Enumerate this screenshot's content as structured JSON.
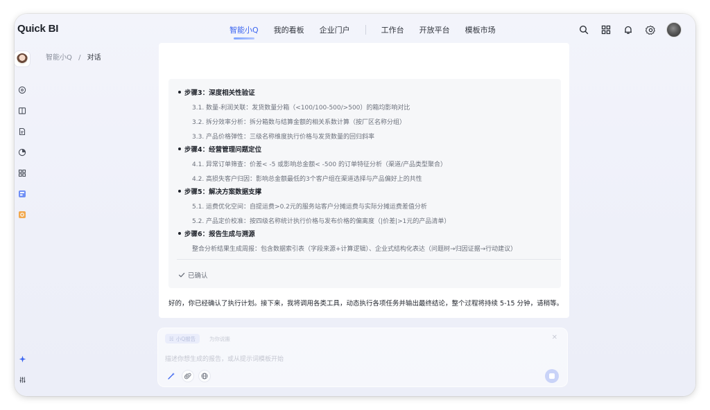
{
  "app": {
    "title": "Quick BI"
  },
  "nav": {
    "tabs": [
      {
        "label": "智能小Q",
        "active": true
      },
      {
        "label": "我的看板"
      },
      {
        "label": "企业门户"
      },
      {
        "label": "工作台"
      },
      {
        "label": "开放平台"
      },
      {
        "label": "模板市场"
      }
    ]
  },
  "header_icons": [
    "search-icon",
    "grid-icon",
    "bell-icon",
    "gear-icon",
    "user-avatar"
  ],
  "rail": {
    "icons": [
      "chat-icon",
      "book-icon",
      "document-icon",
      "data-icon",
      "apps-icon",
      "dashboard-icon",
      "report-icon"
    ],
    "bottom_icons": [
      "sparkle-icon",
      "settings-sliders-icon"
    ]
  },
  "breadcrumb": {
    "root": "智能小Q",
    "sep": "/",
    "current": "对话"
  },
  "plan": {
    "steps": [
      {
        "title": "步骤3：深度相关性验证",
        "lines": [
          "3.1. 数量-利润关联：发货数量分箱（<100/100-500/>500）的箱均影响对比",
          "3.2. 拆分效率分析：拆分箱数与结算金额的相关系数计算（按厂区名称分组）",
          "3.3. 产品价格弹性：三级名称维度执行价格与发货数量的回归斜率"
        ]
      },
      {
        "title": "步骤4：经营管理问题定位",
        "lines": [
          "4.1. 异常订单筛查：价差< -5 或影响总金额< -500 的订单特征分析（渠道/产品类型聚合）",
          "4.2. 高损失客户归因：影响总金额最低的3个客户组在渠道选择与产品偏好上的共性"
        ]
      },
      {
        "title": "步骤5：解决方案数据支撑",
        "lines": [
          "5.1. 运费优化空间：自提运费>0.2元的服务站客户分摊运费与实际分摊运费差值分析",
          "5.2. 产品定价校准：按四级名称统计执行价格与发布价格的偏离度（|价差|>1元的产品清单）"
        ]
      },
      {
        "title": "步骤6：报告生成与溯源",
        "lines": [
          "整合分析结果生成周报：包含数据索引表（字段来源+计算逻辑）、企业式结构化表达（问题树→归因证据→行动建议）"
        ]
      }
    ],
    "confirmed_label": "已确认"
  },
  "reply": "好的，你已经确认了执行计划。接下来，我将调用各类工具，动态执行各项任务并输出最终结论，整个过程将持续 5-15 分钟，请稍等。",
  "input": {
    "chip_label": "小Q报告",
    "chip_sub": "为你说搬",
    "placeholder": "描述你想生成的报告，或从提示词模板开始"
  },
  "colors": {
    "accent": "#3a64f0",
    "send": "#c9d3f8"
  }
}
